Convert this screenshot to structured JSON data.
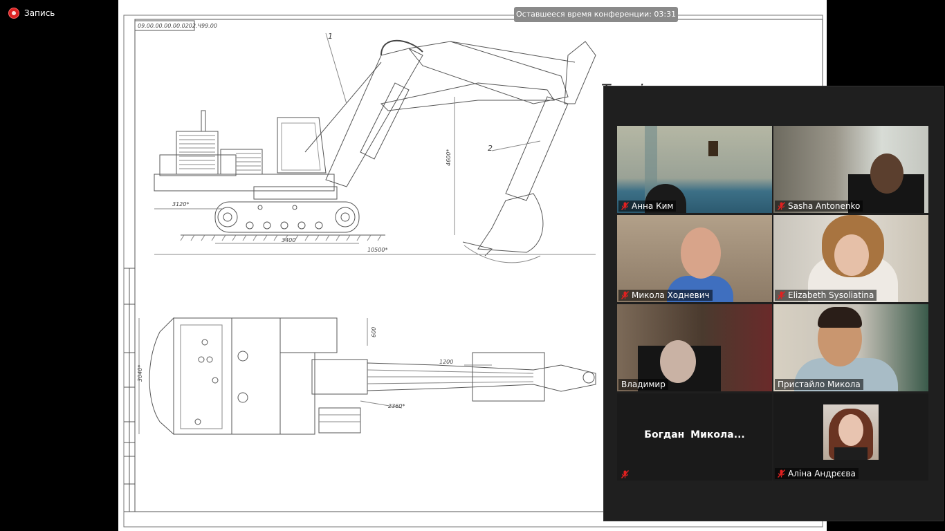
{
  "recording": {
    "label": "Запись"
  },
  "conference": {
    "timer_label": "Оставшееся время конференции:",
    "timer_value": "03:31"
  },
  "drawing": {
    "stamp": "09.00.00.00.00.0202.Ч99.00",
    "callout_1": "1",
    "callout_2": "2",
    "dim_4600": "4600*",
    "dim_3120": "3120*",
    "dim_3400": "3400",
    "dim_10500": "10500*",
    "dim_3040": "3040*",
    "dim_600": "600",
    "dim_1200": "1200",
    "dim_2360": "2360*",
    "title_text": "Технічна характеристика"
  },
  "participants": [
    {
      "name": "Анна Ким",
      "muted": true
    },
    {
      "name": "Sasha Antonenko",
      "muted": true
    },
    {
      "name": "Микола Ходневич",
      "muted": true
    },
    {
      "name": "Elizabeth Sysoliatina",
      "muted": true
    },
    {
      "name": "Владимир",
      "muted": false
    },
    {
      "name": "Пристайло Микола",
      "muted": false
    },
    {
      "name": "",
      "display": "Богдан  Микола...",
      "muted": true
    },
    {
      "name": "Аліна Андрєєва",
      "muted": true
    }
  ],
  "colors": {
    "panel_bg": "#1f1f1f",
    "recording_dot": "#dd2222",
    "mic_muted": "#e02020"
  }
}
